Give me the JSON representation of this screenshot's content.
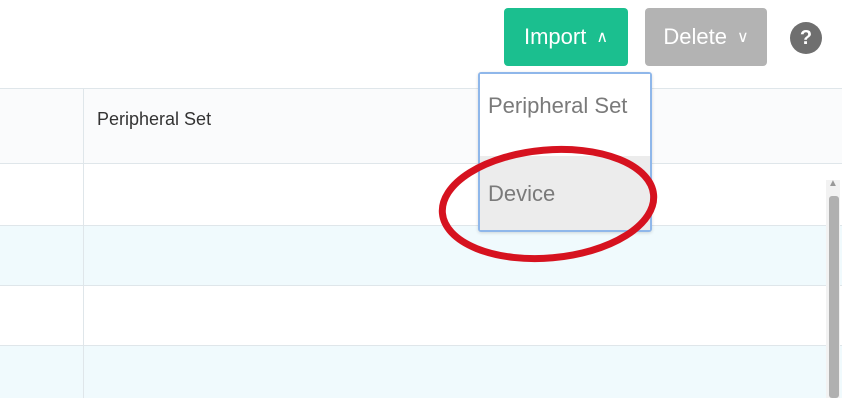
{
  "toolbar": {
    "import_label": "Import",
    "import_chevron": "∧",
    "delete_label": "Delete",
    "delete_chevron": "∨",
    "help_label": "?"
  },
  "table": {
    "columns": [
      "",
      "Peripheral Set"
    ],
    "rows": [
      {
        "cells": [
          "",
          ""
        ]
      },
      {
        "cells": [
          "",
          ""
        ]
      },
      {
        "cells": [
          "",
          ""
        ]
      },
      {
        "cells": [
          "",
          ""
        ]
      }
    ]
  },
  "import_menu": {
    "items": [
      "Peripheral Set",
      "Device"
    ],
    "highlighted": "Device"
  },
  "colors": {
    "import_button": "#1bbf8f",
    "delete_button": "#b3b3b3",
    "menu_border": "#8fb7ea",
    "highlight_circle": "#d6121f",
    "alt_row": "#f0fafd"
  }
}
